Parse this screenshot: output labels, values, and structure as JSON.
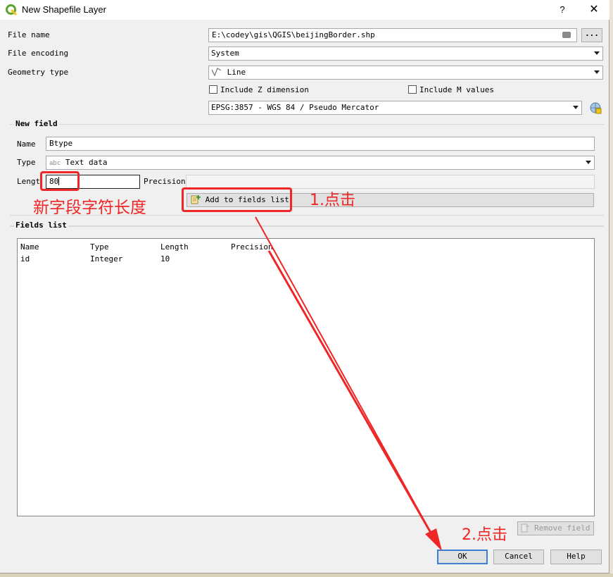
{
  "window": {
    "title": "New Shapefile Layer",
    "help_label": "?",
    "close_label": "✕"
  },
  "form": {
    "file_name_label": "File name",
    "file_name_value": "E:\\codey\\gis\\QGIS\\beijingBorder.shp",
    "browse_label": "...",
    "file_encoding_label": "File encoding",
    "file_encoding_value": "System",
    "geometry_type_label": "Geometry type",
    "geometry_type_value": "Line",
    "include_z_label": "Include Z dimension",
    "include_m_label": "Include M values",
    "crs_value": "EPSG:3857 - WGS 84 / Pseudo Mercator"
  },
  "new_field": {
    "section_title": "New field",
    "name_label": "Name",
    "name_value": "Btype",
    "type_label": "Type",
    "type_prefix": "abc",
    "type_value": "Text data",
    "length_label": "Length",
    "length_value": "80",
    "precision_label": "Precision",
    "precision_value": "",
    "add_button_label": "Add to fields list"
  },
  "fields_list": {
    "section_title": "Fields list",
    "columns": [
      "Name",
      "Type",
      "Length",
      "Precision"
    ],
    "rows": [
      {
        "name": "id",
        "type": "Integer",
        "length": "10",
        "precision": ""
      }
    ],
    "remove_button_label": "Remove field"
  },
  "buttons": {
    "ok": "OK",
    "cancel": "Cancel",
    "help": "Help"
  },
  "annotations": {
    "length_note": "新字段字符长度",
    "step1": "1.点击",
    "step2": "2.点击",
    "color": "#ee2626"
  },
  "colors": {
    "dialog_bg": "#f0f0f0",
    "accent": "#3c7fd6",
    "annotation": "#ee2626"
  }
}
